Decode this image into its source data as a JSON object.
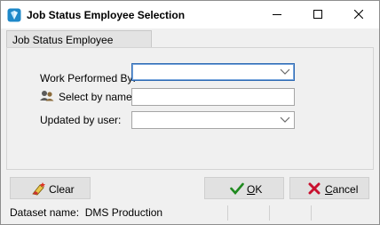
{
  "window": {
    "title": "Job Status Employee Selection",
    "controls": {
      "minimize": "minimize-icon",
      "maximize": "maximize-icon",
      "close": "close-icon"
    }
  },
  "tab": {
    "label": "Job Status Employee Selections"
  },
  "form": {
    "work_performed_by": {
      "label": "Work Performed By:",
      "value": ""
    },
    "select_by_name": {
      "label": "Select by name",
      "value": ""
    },
    "updated_by_user": {
      "label": "Updated by user:",
      "value": ""
    }
  },
  "buttons": {
    "clear": {
      "label": "Clear"
    },
    "ok": {
      "label": "OK",
      "underline": "O",
      "rest": "K"
    },
    "cancel": {
      "label": "Cancel",
      "underline": "C",
      "rest": "ancel"
    }
  },
  "status": {
    "dataset": "Dataset name:  DMS Production"
  },
  "colors": {
    "ok_check": "#1f8a1f",
    "cancel_x": "#c8102e",
    "focus_border": "#2f6ab3"
  }
}
